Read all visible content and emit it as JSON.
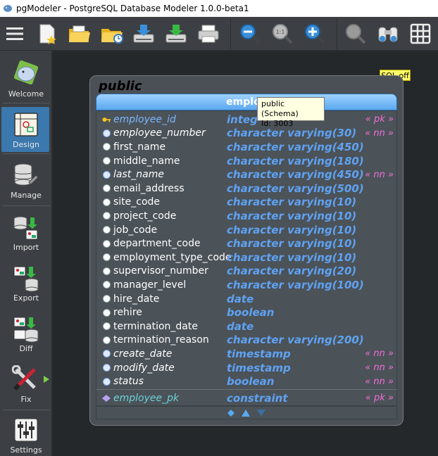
{
  "window": {
    "title": "pgModeler - PostgreSQL Database Modeler 1.0.0-beta1"
  },
  "toolbar": {
    "buttons": [
      "menu-icon",
      "new-model-icon",
      "open-icon",
      "recent-icon",
      "save-icon",
      "save-as-icon",
      "print-icon",
      "zoom-out-icon",
      "zoom-reset-icon",
      "zoom-in-icon",
      "overview-icon",
      "find-icon",
      "grid-icon"
    ]
  },
  "sidebar": {
    "items": [
      {
        "label": "Welcome",
        "icon": "elephant-icon"
      },
      {
        "label": "Design",
        "icon": "design-icon",
        "active": true
      },
      {
        "label": "Manage",
        "icon": "database-tools-icon"
      },
      {
        "label": "Import",
        "icon": "import-icon"
      },
      {
        "label": "Export",
        "icon": "export-icon"
      },
      {
        "label": "Diff",
        "icon": "diff-icon"
      },
      {
        "label": "Fix",
        "icon": "wrench-icon"
      },
      {
        "label": "Settings",
        "icon": "sliders-icon"
      }
    ]
  },
  "canvas": {
    "sql_badge": "SQL off",
    "schema": {
      "name": "public"
    },
    "table": {
      "header_label": "employ",
      "columns": [
        {
          "name": "employee_id",
          "type": "integ",
          "constraint": "« pk »",
          "kind": "pk"
        },
        {
          "name": "employee_number",
          "type": "character varying(30)",
          "constraint": "« nn »",
          "kind": "nn"
        },
        {
          "name": "first_name",
          "type": "character varying(450)",
          "constraint": "",
          "kind": "plain"
        },
        {
          "name": "middle_name",
          "type": "character varying(180)",
          "constraint": "",
          "kind": "plain"
        },
        {
          "name": "last_name",
          "type": "character varying(450)",
          "constraint": "« nn »",
          "kind": "nn"
        },
        {
          "name": "email_address",
          "type": "character varying(500)",
          "constraint": "",
          "kind": "plain"
        },
        {
          "name": "site_code",
          "type": "character varying(10)",
          "constraint": "",
          "kind": "plain"
        },
        {
          "name": "project_code",
          "type": "character varying(10)",
          "constraint": "",
          "kind": "plain"
        },
        {
          "name": "job_code",
          "type": "character varying(10)",
          "constraint": "",
          "kind": "plain"
        },
        {
          "name": "department_code",
          "type": "character varying(10)",
          "constraint": "",
          "kind": "plain"
        },
        {
          "name": "employment_type_code",
          "type": "character varying(10)",
          "constraint": "",
          "kind": "plain"
        },
        {
          "name": "supervisor_number",
          "type": "character varying(20)",
          "constraint": "",
          "kind": "plain"
        },
        {
          "name": "manager_level",
          "type": "character varying(100)",
          "constraint": "",
          "kind": "plain"
        },
        {
          "name": "hire_date",
          "type": "date",
          "constraint": "",
          "kind": "plain"
        },
        {
          "name": "rehire",
          "type": "boolean",
          "constraint": "",
          "kind": "plain"
        },
        {
          "name": "termination_date",
          "type": "date",
          "constraint": "",
          "kind": "plain"
        },
        {
          "name": "termination_reason",
          "type": "character varying(200)",
          "constraint": "",
          "kind": "plain"
        },
        {
          "name": "create_date",
          "type": "timestamp",
          "constraint": "« nn »",
          "kind": "nn"
        },
        {
          "name": "modify_date",
          "type": "timestamp",
          "constraint": "« nn »",
          "kind": "nn"
        },
        {
          "name": "status",
          "type": "boolean",
          "constraint": "« nn »",
          "kind": "nn"
        }
      ],
      "extended": [
        {
          "name": "employee_pk",
          "type": "constraint",
          "constraint": "« pk »",
          "kind": "constraint"
        }
      ]
    },
    "tooltip": {
      "line1": "public (Schema)",
      "line2": "Id: 3003"
    }
  },
  "colors": {
    "accent": "#3a78ad",
    "type_blue": "#5fa2f2",
    "constraint_pink": "#f26ed8",
    "pk_name": "#7cb7ff"
  }
}
